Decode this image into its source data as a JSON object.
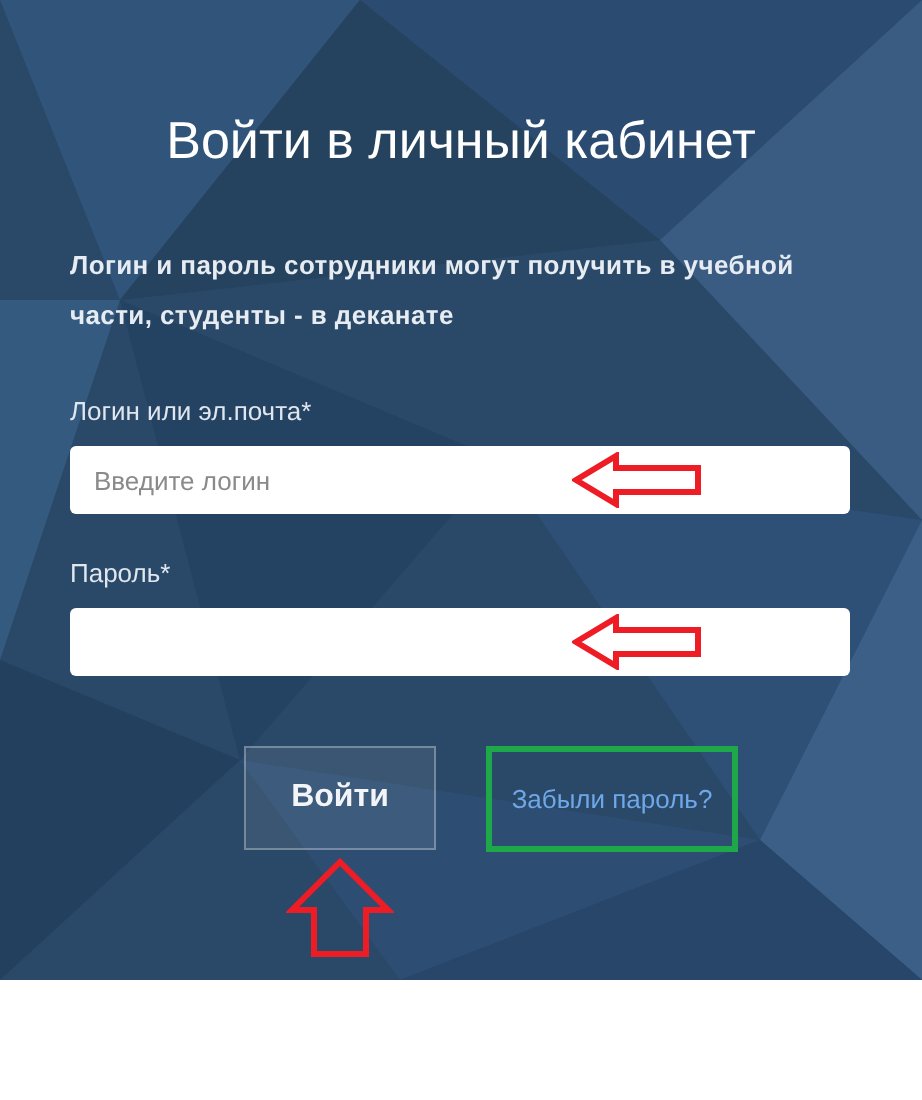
{
  "title": "Войти в личный кабинет",
  "note": "Логин и пароль сотрудники могут получить в учебной части, студенты - в деканате",
  "fields": [
    {
      "label": "Логин или эл.почта*",
      "placeholder": "Введите логин"
    },
    {
      "label": "Пароль*"
    }
  ],
  "submit_button": "Войти",
  "forgot_link": "Забыли пароль?"
}
